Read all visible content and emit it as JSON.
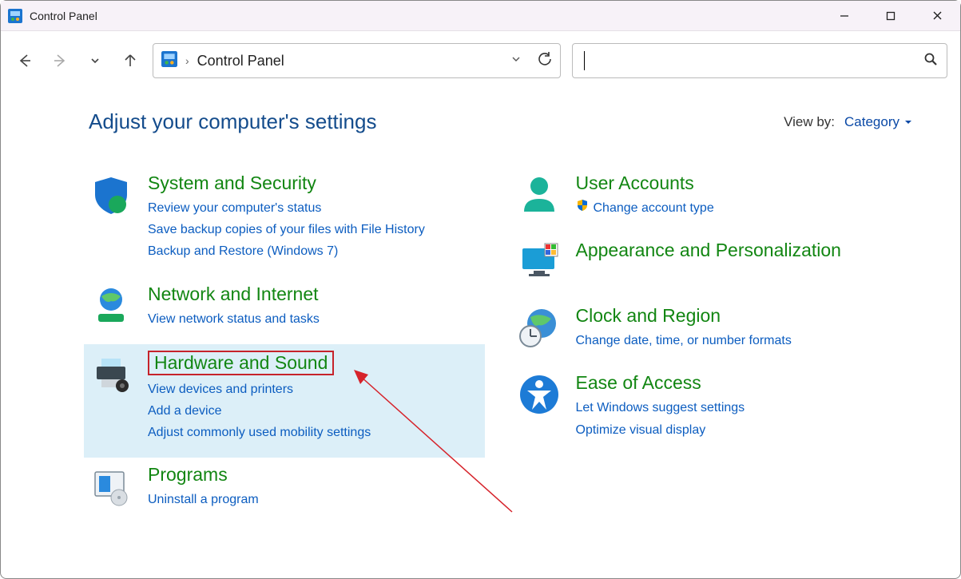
{
  "window": {
    "title": "Control Panel"
  },
  "address": {
    "crumb": "Control Panel"
  },
  "search": {
    "placeholder": ""
  },
  "header": {
    "title": "Adjust your computer's settings",
    "viewby_label": "View by:",
    "viewby_value": "Category"
  },
  "left": {
    "system": {
      "title": "System and Security",
      "l1": "Review your computer's status",
      "l2": "Save backup copies of your files with File History",
      "l3": "Backup and Restore (Windows 7)"
    },
    "network": {
      "title": "Network and Internet",
      "l1": "View network status and tasks"
    },
    "hardware": {
      "title": "Hardware and Sound",
      "l1": "View devices and printers",
      "l2": "Add a device",
      "l3": "Adjust commonly used mobility settings"
    },
    "programs": {
      "title": "Programs",
      "l1": "Uninstall a program"
    }
  },
  "right": {
    "user": {
      "title": "User Accounts",
      "l1": "Change account type"
    },
    "appearance": {
      "title": "Appearance and Personalization"
    },
    "clock": {
      "title": "Clock and Region",
      "l1": "Change date, time, or number formats"
    },
    "ease": {
      "title": "Ease of Access",
      "l1": "Let Windows suggest settings",
      "l2": "Optimize visual display"
    }
  }
}
